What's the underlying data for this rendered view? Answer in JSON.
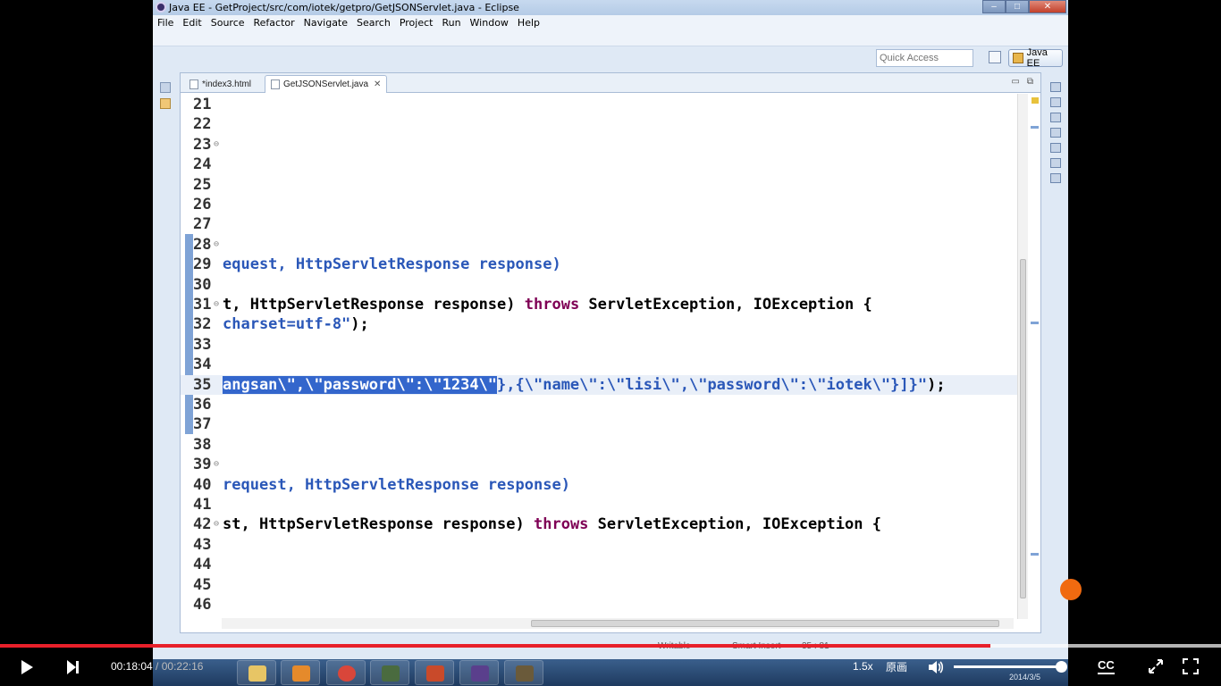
{
  "window": {
    "title": "Java EE - GetProject/src/com/iotek/getpro/GetJSONServlet.java - Eclipse",
    "controls": [
      "–",
      "□",
      "✕"
    ]
  },
  "menu": {
    "items": [
      "File",
      "Edit",
      "Source",
      "Refactor",
      "Navigate",
      "Search",
      "Project",
      "Run",
      "Window",
      "Help"
    ]
  },
  "perspective": {
    "quick_access_placeholder": "Quick Access",
    "active": "Java EE"
  },
  "editor": {
    "tabs": [
      {
        "label": "*index3.html",
        "active": false
      },
      {
        "label": "GetJSONServlet.java",
        "active": true
      }
    ],
    "lines": [
      {
        "num": "21",
        "parts": []
      },
      {
        "num": "22",
        "parts": []
      },
      {
        "num": "23",
        "fold": "⊖",
        "parts": []
      },
      {
        "num": "24",
        "parts": []
      },
      {
        "num": "25",
        "parts": []
      },
      {
        "num": "26",
        "parts": []
      },
      {
        "num": "27",
        "parts": []
      },
      {
        "num": "28",
        "fold": "⊖",
        "parts": []
      },
      {
        "num": "29",
        "parts": [
          {
            "text": "equest, HttpServletResponse response)",
            "cls": "blue"
          }
        ]
      },
      {
        "num": "30",
        "parts": []
      },
      {
        "num": "31",
        "fold": "⊖",
        "parts": [
          {
            "text": "t, HttpServletResponse response) ",
            "cls": ""
          },
          {
            "text": "throws",
            "cls": "kw"
          },
          {
            "text": " ServletException, IOException {",
            "cls": ""
          }
        ]
      },
      {
        "num": "32",
        "parts": [
          {
            "text": "charset=utf-8\"",
            "cls": "blue"
          },
          {
            "text": ");",
            "cls": ""
          }
        ]
      },
      {
        "num": "33",
        "parts": []
      },
      {
        "num": "34",
        "parts": []
      },
      {
        "num": "35",
        "current": true,
        "parts": [
          {
            "text": "angsan\\\",\\\"password\\\":\\\"1234\\\"",
            "cls": "sel"
          },
          {
            "text": "},{\\\"name\\\":\\\"lisi\\\",\\\"password\\\":\\\"iotek\\\"}]}\"",
            "cls": "blue"
          },
          {
            "text": ");",
            "cls": ""
          }
        ]
      },
      {
        "num": "36",
        "parts": []
      },
      {
        "num": "37",
        "parts": []
      },
      {
        "num": "38",
        "parts": []
      },
      {
        "num": "39",
        "fold": "⊖",
        "parts": []
      },
      {
        "num": "40",
        "parts": [
          {
            "text": "request, HttpServletResponse response)",
            "cls": "blue"
          }
        ]
      },
      {
        "num": "41",
        "parts": []
      },
      {
        "num": "42",
        "fold": "⊖",
        "parts": [
          {
            "text": "st, HttpServletResponse response) ",
            "cls": ""
          },
          {
            "text": "throws",
            "cls": "kw"
          },
          {
            "text": " ServletException, IOException {",
            "cls": ""
          }
        ]
      },
      {
        "num": "43",
        "parts": []
      },
      {
        "num": "44",
        "parts": []
      },
      {
        "num": "45",
        "parts": []
      },
      {
        "num": "46",
        "parts": []
      }
    ]
  },
  "status": {
    "writable": "Writable",
    "insert_mode": "Smart Insert",
    "position": "35 : 81"
  },
  "taskbar": {
    "date": "2014/3/5"
  },
  "player": {
    "current_time": "00:18:04",
    "duration": "00:22:16",
    "progress": 0.811,
    "buffered": 1.0,
    "speed": "1.5x",
    "quality": "原画",
    "volume": 0.99,
    "cc_label": "CC",
    "accent_color": "#e8202a"
  }
}
